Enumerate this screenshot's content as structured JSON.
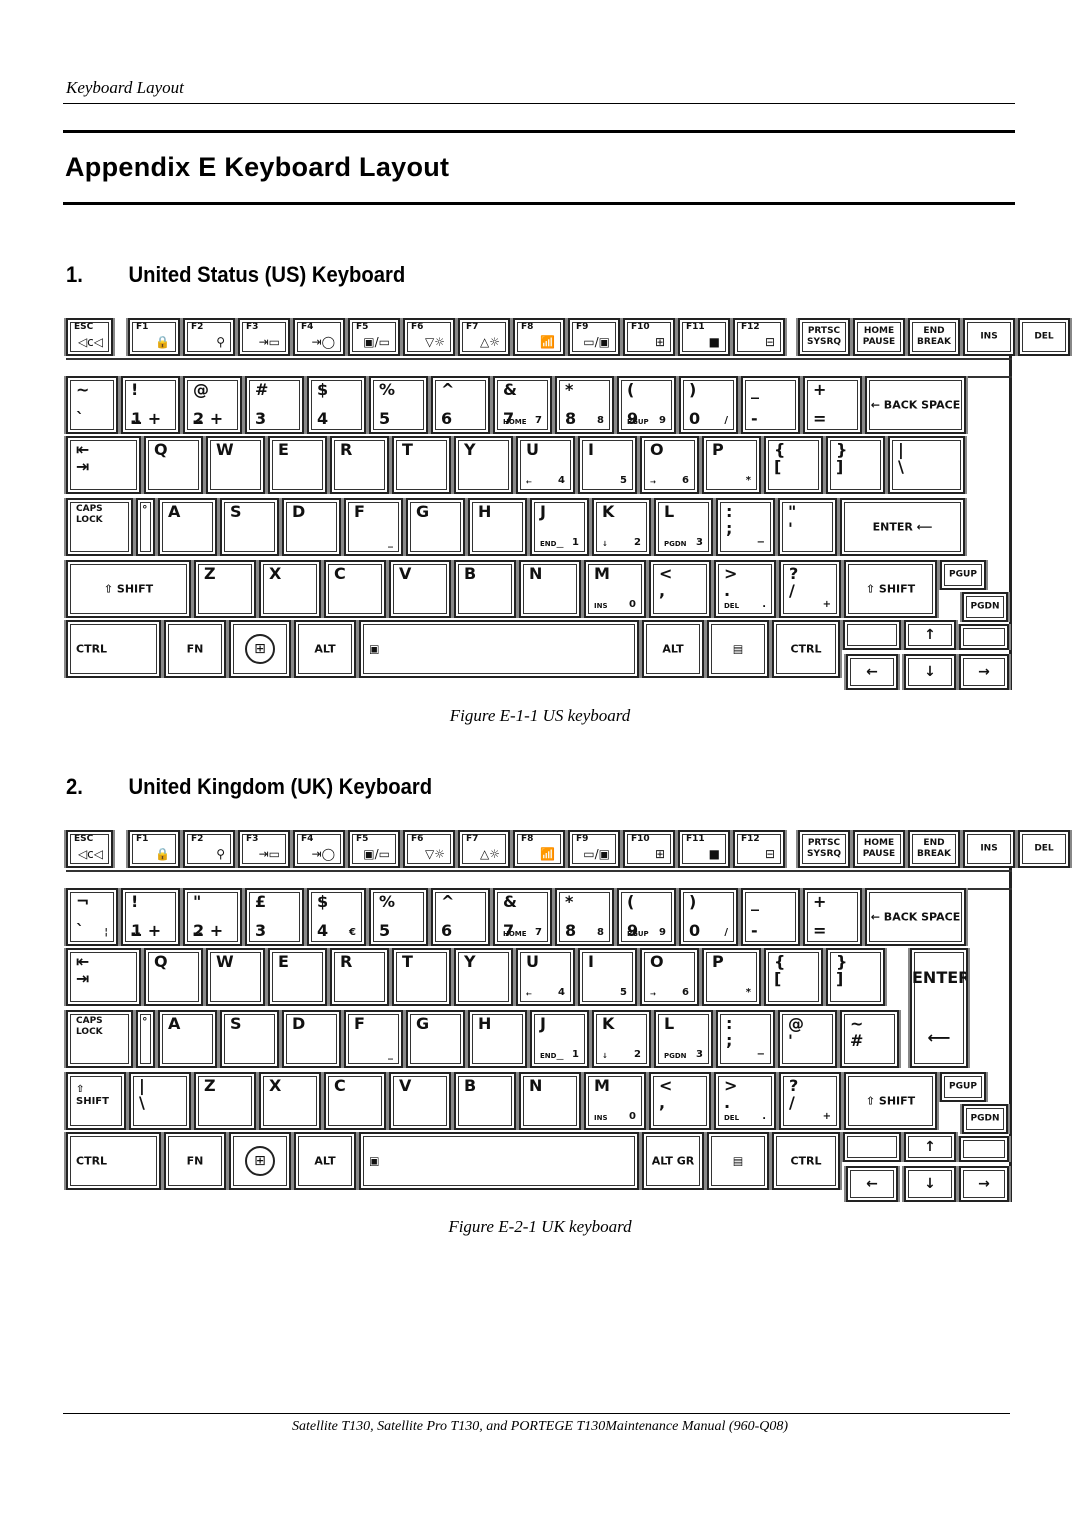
{
  "header": {
    "running_head": "Keyboard Layout",
    "title": "Appendix E  Keyboard Layout"
  },
  "sections": [
    {
      "number": "1.",
      "heading": "United Status (US) Keyboard",
      "caption": "Figure E-1-1 US keyboard"
    },
    {
      "number": "2.",
      "heading": "United Kingdom (UK) Keyboard",
      "caption": "Figure E-2-1 UK keyboard"
    }
  ],
  "keyboards": {
    "us": {
      "fn_row": [
        {
          "label": "ESC",
          "icon": "◁ⅽ◁"
        },
        {
          "label": "F1",
          "icon": "🔒"
        },
        {
          "label": "F2",
          "icon": "⚲"
        },
        {
          "label": "F3",
          "icon": "⇥▭"
        },
        {
          "label": "F4",
          "icon": "⇥◯"
        },
        {
          "label": "F5",
          "icon": "▣/▭"
        },
        {
          "label": "F6",
          "icon": "▽☼"
        },
        {
          "label": "F7",
          "icon": "△☼"
        },
        {
          "label": "F8",
          "icon": "📶"
        },
        {
          "label": "F9",
          "icon": "▭/▣"
        },
        {
          "label": "F10",
          "icon": "⊞"
        },
        {
          "label": "F11",
          "icon": "■"
        },
        {
          "label": "F12",
          "icon": "⊟"
        }
      ],
      "nav_row": [
        {
          "label": "PRTSC\nSYSRQ"
        },
        {
          "label": "HOME\nPAUSE"
        },
        {
          "label": "END\nBREAK"
        },
        {
          "label": "INS"
        },
        {
          "label": "DEL"
        }
      ],
      "number_row": [
        {
          "top": "~",
          "bottom": "`"
        },
        {
          "top": "!",
          "bottom": "1 +",
          "sub": "▪▪"
        },
        {
          "top": "@",
          "bottom": "2 +",
          "sub": "▪▪"
        },
        {
          "top": "#",
          "bottom": "3"
        },
        {
          "top": "$",
          "bottom": "4"
        },
        {
          "top": "%",
          "bottom": "5"
        },
        {
          "top": "^",
          "bottom": "6"
        },
        {
          "top": "&",
          "bottom": "7",
          "sub": "HOME",
          "num": "7"
        },
        {
          "top": "*",
          "bottom": "8",
          "sub": "↑",
          "num": "8"
        },
        {
          "top": "(",
          "bottom": "9",
          "sub": "PGUP",
          "num": "9"
        },
        {
          "top": ")",
          "bottom": "0",
          "num": "/"
        },
        {
          "top": "_",
          "bottom": "-"
        },
        {
          "top": "+",
          "bottom": "="
        },
        {
          "label": "← BACK\nSPACE"
        }
      ],
      "qwerty_row": [
        {
          "label": "⇤\n⇥"
        },
        {
          "label": "Q"
        },
        {
          "label": "W"
        },
        {
          "label": "E"
        },
        {
          "label": "R"
        },
        {
          "label": "T"
        },
        {
          "label": "Y"
        },
        {
          "label": "U",
          "sub": "←",
          "num": "4"
        },
        {
          "label": "I",
          "num": "5"
        },
        {
          "label": "O",
          "sub": "→",
          "num": "6"
        },
        {
          "label": "P",
          "num": "*"
        },
        {
          "label": "{\n["
        },
        {
          "label": "}\n]"
        },
        {
          "label": "|\n\\"
        }
      ],
      "home_row": [
        {
          "label": "CAPS\nLOCK"
        },
        {
          "label": "°"
        },
        {
          "label": "A"
        },
        {
          "label": "S"
        },
        {
          "label": "D"
        },
        {
          "label": "F",
          "num": "_"
        },
        {
          "label": "G"
        },
        {
          "label": "H"
        },
        {
          "label": "J",
          "sub": "END__",
          "num": "1"
        },
        {
          "label": "K",
          "sub": "↓",
          "num": "2"
        },
        {
          "label": "L",
          "sub": "PGDN",
          "num": "3"
        },
        {
          "label": ":\n;",
          "num": "−"
        },
        {
          "label": "\"\n'"
        },
        {
          "label": "ENTER ⟵"
        }
      ],
      "shift_row": [
        {
          "label": "⇧ SHIFT"
        },
        {
          "label": "Z"
        },
        {
          "label": "X"
        },
        {
          "label": "C"
        },
        {
          "label": "V"
        },
        {
          "label": "B"
        },
        {
          "label": "N"
        },
        {
          "label": "M",
          "sub": "INS",
          "num": "0"
        },
        {
          "label": "<\n,"
        },
        {
          "label": ">\n.",
          "sub": "DEL",
          "num": "."
        },
        {
          "label": "?\n/",
          "num": "+"
        },
        {
          "label": "⇧ SHIFT"
        },
        {
          "label": "PGUP"
        }
      ],
      "bottom_row": [
        {
          "label": "CTRL"
        },
        {
          "label": "FN"
        },
        {
          "label": "⊞"
        },
        {
          "label": "ALT"
        },
        {
          "label": "▣"
        },
        {
          "label": "ALT"
        },
        {
          "label": "▤"
        },
        {
          "label": "CTRL"
        },
        {
          "label": "PGDN"
        }
      ],
      "arrows": {
        "up": "↑",
        "left": "←",
        "down": "↓",
        "right": "→"
      }
    },
    "uk": {
      "number_row": [
        {
          "top": "¬",
          "bottom": "`",
          "alt": "¦"
        },
        {
          "top": "!",
          "bottom": "1 +",
          "sub": "▪▪"
        },
        {
          "top": "\"",
          "bottom": "2 +",
          "sub": "▪▪"
        },
        {
          "top": "£",
          "bottom": "3"
        },
        {
          "top": "$",
          "bottom": "4",
          "num": "€"
        },
        {
          "top": "%",
          "bottom": "5"
        },
        {
          "top": "^",
          "bottom": "6"
        },
        {
          "top": "&",
          "bottom": "7",
          "sub": "HOME",
          "num": "7"
        },
        {
          "top": "*",
          "bottom": "8",
          "sub": "↑",
          "num": "8"
        },
        {
          "top": "(",
          "bottom": "9",
          "sub": "PGUP",
          "num": "9"
        },
        {
          "top": ")",
          "bottom": "0",
          "num": "/"
        },
        {
          "top": "_",
          "bottom": "-"
        },
        {
          "top": "+",
          "bottom": "="
        },
        {
          "label": "← BACK\nSPACE"
        }
      ],
      "qwerty_row_extra": [
        {
          "label": "{\n["
        },
        {
          "label": "}\n]"
        },
        {
          "label": "ENTER"
        }
      ],
      "home_row_extra": [
        {
          "label": "@\n'"
        },
        {
          "label": "~\n#"
        },
        {
          "label": "⟵"
        }
      ],
      "shift_row_left": [
        {
          "label": "⇧\nSHIFT"
        },
        {
          "label": "|\n\\"
        }
      ],
      "alt_gr": "ALT\nGR"
    }
  }
}
